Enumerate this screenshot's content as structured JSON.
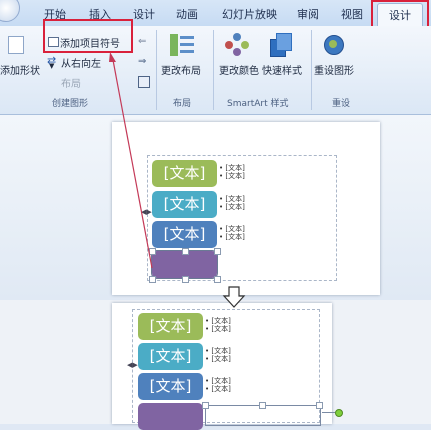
{
  "tabs": [
    "开始",
    "插入",
    "设计",
    "动画",
    "幻灯片放映",
    "审阅",
    "视图",
    "设计"
  ],
  "ribbon": {
    "add_shape": "添加形状",
    "add_bullet": "添加项目符号",
    "right_to_left": "从右向左",
    "layout_small": "布局",
    "change_layout": "更改布局",
    "change_colors": "更改颜色",
    "quick_styles": "快速样式",
    "reset_graphic": "重设图形",
    "group_create": "创建图形",
    "group_layout": "布局",
    "group_styles": "SmartArt 样式",
    "group_reset": "重设"
  },
  "smartart": {
    "card_text": "[文本]",
    "bullet_text": "[文本]"
  },
  "colors": {
    "green": "#9bbb59",
    "teal": "#4bacc6",
    "blue": "#4f81bd",
    "purple": "#8064a2",
    "highlight": "#d9213b"
  },
  "icons": [
    "add-shape-icon",
    "add-bullet-icon",
    "right-to-left-icon",
    "change-layout-icon",
    "change-colors-icon",
    "quick-styles-icon",
    "reset-graphic-icon",
    "down-arrow-icon"
  ]
}
